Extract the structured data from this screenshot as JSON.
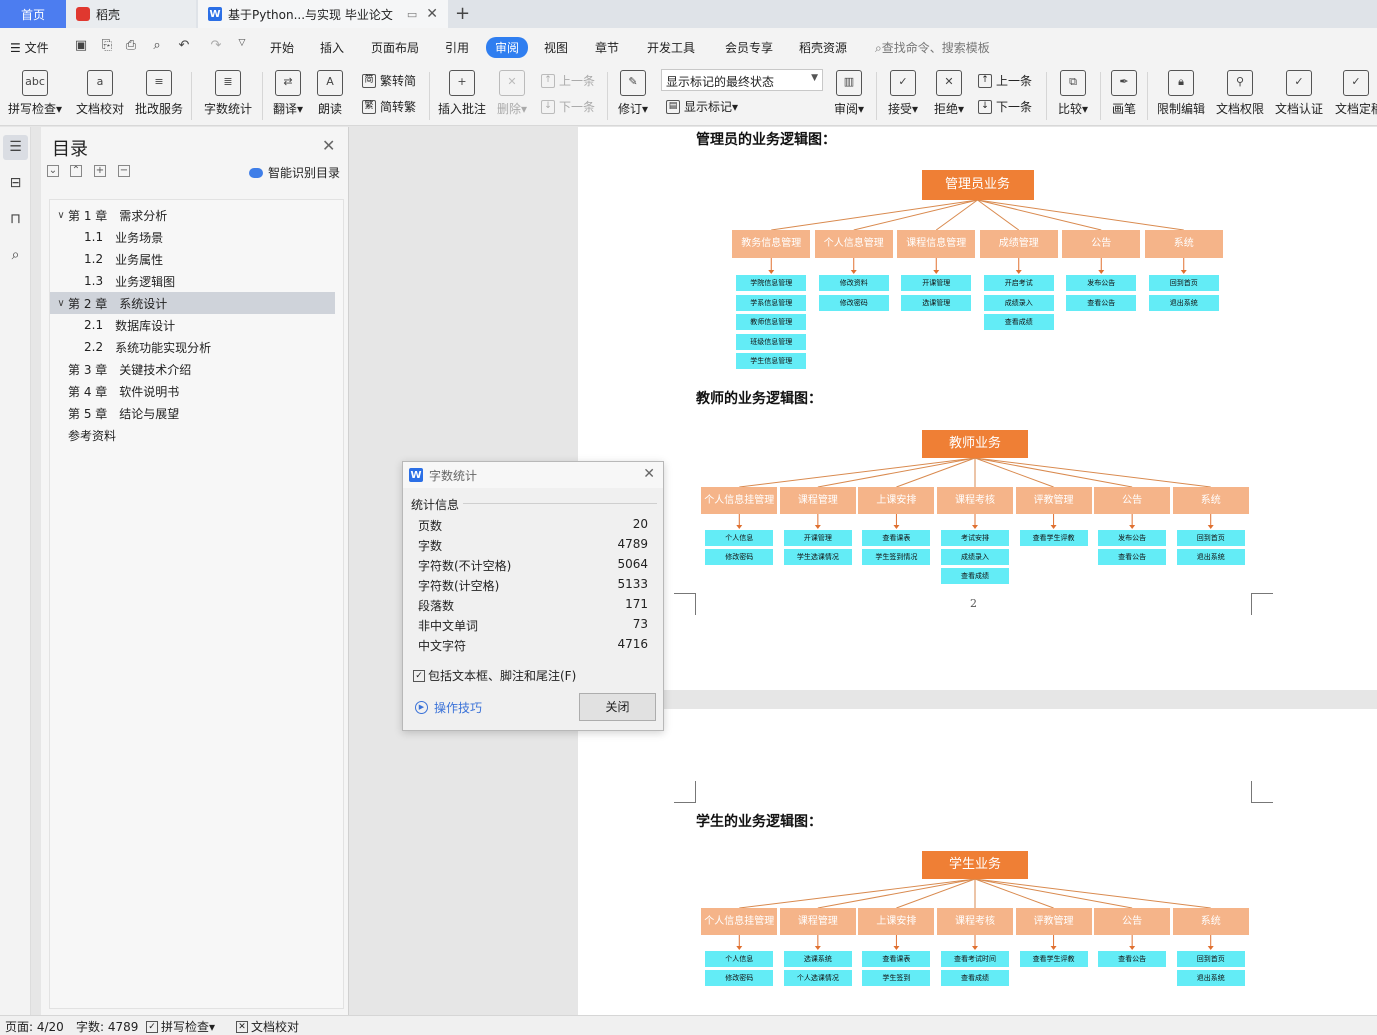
{
  "tabs": {
    "home": "首页",
    "daoke": "稻壳",
    "doc": "基于Python...与实现 毕业论文",
    "add": "+"
  },
  "menu": {
    "file": "文件",
    "items": [
      "开始",
      "插入",
      "页面布局",
      "引用",
      "审阅",
      "视图",
      "章节",
      "开发工具",
      "会员专享",
      "稻壳资源"
    ],
    "search": "查找命令、搜索模板"
  },
  "ribbon": {
    "spell": "拼写检查",
    "proof": "文档校对",
    "correct": "批改服务",
    "wordcount": "字数统计",
    "translate": "翻译",
    "read": "朗读",
    "to_trad": "繁转简",
    "to_simp": "简转繁",
    "insert_comment": "插入批注",
    "delete": "删除",
    "prev_comment": "上一条",
    "next_comment": "下一条",
    "revise": "修订",
    "markup_mode": "显示标记的最终状态",
    "show_markup": "显示标记",
    "review": "审阅",
    "accept": "接受",
    "reject": "拒绝",
    "prev_change": "上一条",
    "next_change": "下一条",
    "compare": "比较",
    "ink": "画笔",
    "restrict": "限制编辑",
    "permission": "文档权限",
    "certify": "文档认证",
    "finalize": "文档定稿"
  },
  "toc": {
    "title": "目录",
    "smart": "智能识别目录",
    "items": [
      {
        "num": "第 1 章",
        "text": "需求分析",
        "level": 1,
        "caret": "﹀"
      },
      {
        "num": "1.1",
        "text": "业务场景",
        "level": 2
      },
      {
        "num": "1.2",
        "text": "业务属性",
        "level": 2
      },
      {
        "num": "1.3",
        "text": "业务逻辑图",
        "level": 2
      },
      {
        "num": "第 2 章",
        "text": "系统设计",
        "level": 1,
        "caret": "﹀",
        "selected": true
      },
      {
        "num": "2.1",
        "text": "数据库设计",
        "level": 2
      },
      {
        "num": "2.2",
        "text": "系统功能实现分析",
        "level": 2
      },
      {
        "num": "第 3 章",
        "text": "关键技术介绍",
        "level": 1
      },
      {
        "num": "第 4 章",
        "text": "软件说明书",
        "level": 1
      },
      {
        "num": "第 5 章",
        "text": "结论与展望",
        "level": 1
      },
      {
        "num": "",
        "text": "参考资料",
        "level": 1
      }
    ]
  },
  "doc": {
    "admin_heading": "管理员的业务逻辑图：",
    "teacher_heading": "教师的业务逻辑图：",
    "student_heading": "学生的业务逻辑图：",
    "page_number": "2"
  },
  "diagrams": {
    "admin": {
      "root": "管理员业务",
      "categories": [
        {
          "label": "教务信息管理",
          "leaves": [
            "学院信息管理",
            "学系信息管理",
            "教师信息管理",
            "班级信息管理",
            "学生信息管理"
          ]
        },
        {
          "label": "个人信息管理",
          "leaves": [
            "修改资料",
            "修改密码"
          ]
        },
        {
          "label": "课程信息管理",
          "leaves": [
            "开课管理",
            "选课管理"
          ]
        },
        {
          "label": "成绩管理",
          "leaves": [
            "开启考试",
            "成绩录入",
            "查看成绩"
          ]
        },
        {
          "label": "公告",
          "leaves": [
            "发布公告",
            "查看公告"
          ]
        },
        {
          "label": "系统",
          "leaves": [
            "回到首页",
            "退出系统"
          ]
        }
      ]
    },
    "teacher": {
      "root": "教师业务",
      "categories": [
        {
          "label": "个人信息挂管理",
          "leaves": [
            "个人信息",
            "修改密码"
          ]
        },
        {
          "label": "课程管理",
          "leaves": [
            "开课管理",
            "学生选课情况"
          ]
        },
        {
          "label": "上课安排",
          "leaves": [
            "查看课表",
            "学生签到情况"
          ]
        },
        {
          "label": "课程考核",
          "leaves": [
            "考试安排",
            "成绩录入",
            "查看成绩"
          ]
        },
        {
          "label": "评教管理",
          "leaves": [
            "查看学生评教"
          ]
        },
        {
          "label": "公告",
          "leaves": [
            "发布公告",
            "查看公告"
          ]
        },
        {
          "label": "系统",
          "leaves": [
            "回到首页",
            "退出系统"
          ]
        }
      ]
    },
    "student": {
      "root": "学生业务",
      "categories": [
        {
          "label": "个人信息挂管理",
          "leaves": [
            "个人信息",
            "修改密码"
          ]
        },
        {
          "label": "课程管理",
          "leaves": [
            "选课系统",
            "个人选课情况"
          ]
        },
        {
          "label": "上课安排",
          "leaves": [
            "查看课表",
            "学生签到"
          ]
        },
        {
          "label": "课程考核",
          "leaves": [
            "查看考试时间",
            "查看成绩"
          ]
        },
        {
          "label": "评教管理",
          "leaves": [
            "查看学生评教"
          ]
        },
        {
          "label": "公告",
          "leaves": [
            "查看公告"
          ]
        },
        {
          "label": "系统",
          "leaves": [
            "回到首页",
            "退出系统"
          ]
        }
      ]
    }
  },
  "wordcount": {
    "title": "字数统计",
    "section": "统计信息",
    "rows": [
      {
        "label": "页数",
        "value": "20"
      },
      {
        "label": "字数",
        "value": "4789"
      },
      {
        "label": "字符数(不计空格)",
        "value": "5064"
      },
      {
        "label": "字符数(计空格)",
        "value": "5133"
      },
      {
        "label": "段落数",
        "value": "171"
      },
      {
        "label": "非中文单词",
        "value": "73"
      },
      {
        "label": "中文字符",
        "value": "4716"
      }
    ],
    "include": "包括文本框、脚注和尾注(F)",
    "tips": "操作技巧",
    "close": "关闭"
  },
  "status": {
    "page": "页面: 4/20",
    "words": "字数: 4789",
    "spell": "拼写检查",
    "proof": "文档校对"
  },
  "colors": {
    "accent": "#2f7ef0",
    "root_box": "#ef7f35",
    "category_box": "#f5b489",
    "leaf_box": "#63ecf6"
  }
}
